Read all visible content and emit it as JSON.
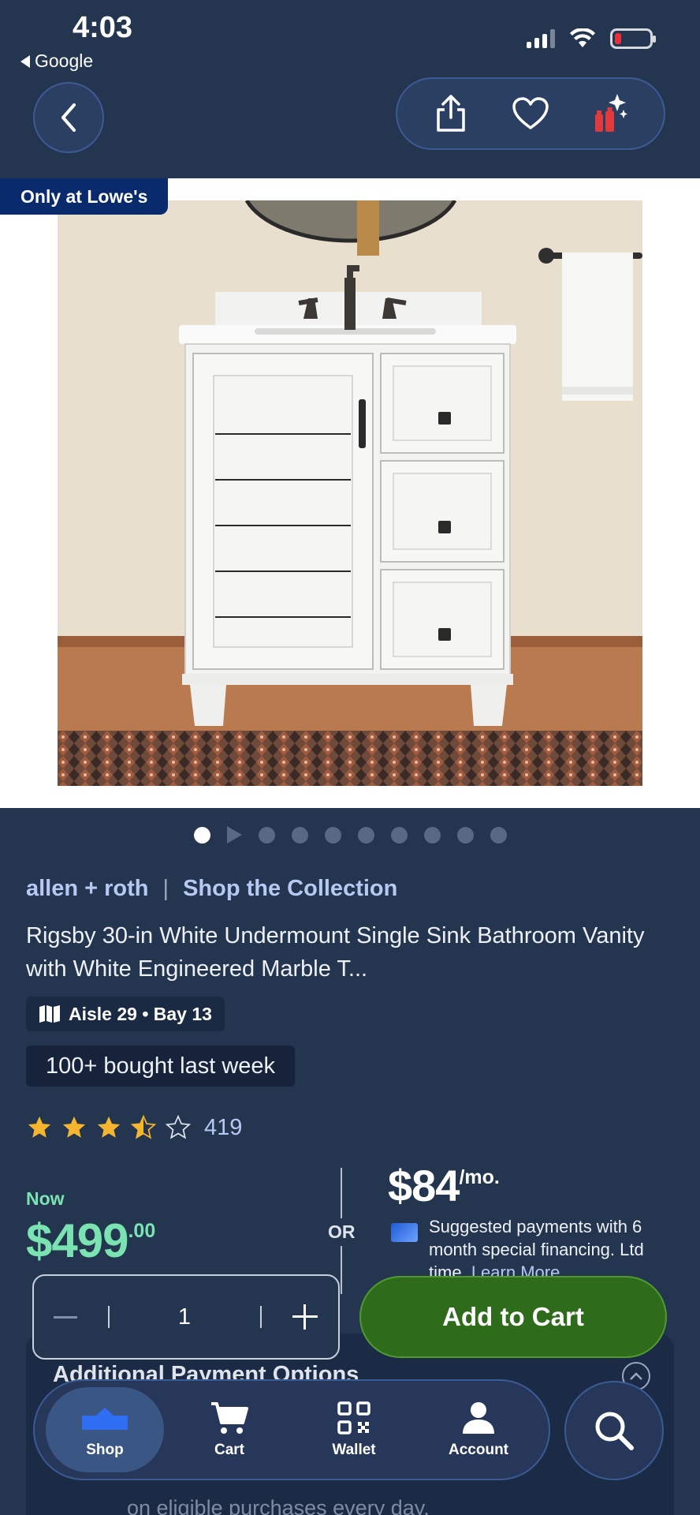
{
  "status_bar": {
    "time": "4:03",
    "back_app": "Google"
  },
  "badge": {
    "only_at": "Only at Lowe's"
  },
  "carousel": {
    "total_dots": 10,
    "active_index": 0
  },
  "product": {
    "brand": "allen + roth",
    "collection_link": "Shop the Collection",
    "title": "Rigsby 30-in White Undermount Single Sink Bathroom Vanity with White Engineered Marble T...",
    "aisle": "Aisle 29 • Bay 13",
    "bought_note": "100+ bought last week",
    "rating": {
      "stars": 3.5,
      "max": 5,
      "count": "419"
    }
  },
  "pricing": {
    "now_label": "Now",
    "price_dollars": "$499",
    "price_cents": ".00",
    "or_label": "OR",
    "monthly_amount": "$84",
    "monthly_suffix": "/mo.",
    "financing_text": "Suggested payments with 6 month special financing. Ltd time.",
    "learn_more": "Learn More"
  },
  "cart": {
    "quantity": "1",
    "add_to_cart": "Add to Cart"
  },
  "additional_payment": {
    "heading": "Additional Payment Options",
    "partial_text": "on eligible purchases every day."
  },
  "tab_bar": {
    "shop": "Shop",
    "cart": "Cart",
    "wallet": "Wallet",
    "account": "Account"
  },
  "colors": {
    "background": "#243550",
    "price_green": "#7be3b2",
    "add_to_cart": "#2e6b1a",
    "brand_blue": "#0a2a6e",
    "link": "#b7c9f2",
    "star": "#f5b52e"
  }
}
